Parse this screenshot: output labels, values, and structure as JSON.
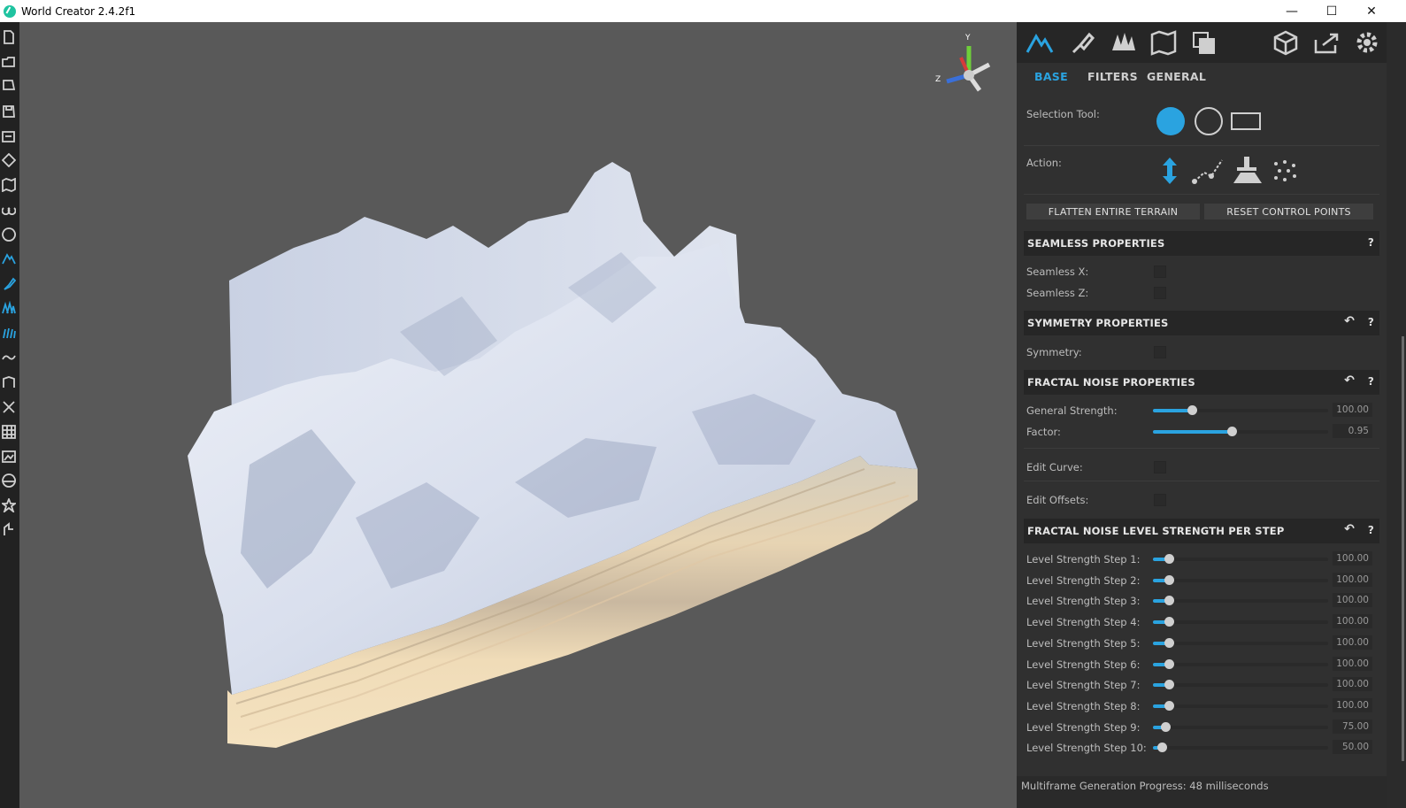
{
  "window": {
    "title": "World Creator 2.4.2f1",
    "minimize": "—",
    "maximize": "☐",
    "close": "✕"
  },
  "gizmo": {
    "y": "Y",
    "z": "Z"
  },
  "left_toolbar": {
    "icons": [
      "new-file-icon",
      "open-folder-icon",
      "open-recent-icon",
      "save-icon",
      "save-as-icon",
      "import-icon",
      "map-icon",
      "binoculars-icon",
      "globe-icon",
      "terrain-icon",
      "brush-icon",
      "trees-icon",
      "grass-icon",
      "river-icon",
      "texture-icon",
      "nodes-icon",
      "grid-icon",
      "image-icon",
      "sphere-icon",
      "settings-star-icon",
      "tool-icon"
    ]
  },
  "top_icons": [
    "terrain-tool-icon",
    "paint-brush-icon",
    "forest-icon",
    "map-layers-icon",
    "stack-icon",
    "cube-export-icon",
    "share-icon",
    "settings-gear-icon"
  ],
  "tabs": [
    {
      "label": "BASE",
      "active": true
    },
    {
      "label": "FILTERS",
      "active": false
    },
    {
      "label": "GENERAL",
      "active": false
    }
  ],
  "selection_tool": {
    "label": "Selection Tool:"
  },
  "action": {
    "label": "Action:"
  },
  "buttons": {
    "flatten": "FLATTEN ENTIRE TERRAIN",
    "reset": "RESET CONTROL POINTS"
  },
  "seamless": {
    "title": "SEAMLESS PROPERTIES",
    "help": "?",
    "x_label": "Seamless X:",
    "z_label": "Seamless Z:"
  },
  "symmetry": {
    "title": "SYMMETRY PROPERTIES",
    "help": "?",
    "label": "Symmetry:"
  },
  "fractal": {
    "title": "FRACTAL NOISE PROPERTIES",
    "help": "?",
    "general_strength_label": "General Strength:",
    "general_strength_value": "100.00",
    "general_strength_fraction": 0.22,
    "factor_label": "Factor:",
    "factor_value": "0.95",
    "factor_fraction": 0.45,
    "edit_curve_label": "Edit Curve:",
    "edit_offsets_label": "Edit Offsets:"
  },
  "levels": {
    "title": "FRACTAL NOISE LEVEL STRENGTH PER STEP",
    "help": "?",
    "steps": [
      {
        "label": "Level Strength Step 1:",
        "value": "100.00",
        "fraction": 0.09
      },
      {
        "label": "Level Strength Step 2:",
        "value": "100.00",
        "fraction": 0.09
      },
      {
        "label": "Level Strength Step 3:",
        "value": "100.00",
        "fraction": 0.09
      },
      {
        "label": "Level Strength Step 4:",
        "value": "100.00",
        "fraction": 0.09
      },
      {
        "label": "Level Strength Step 5:",
        "value": "100.00",
        "fraction": 0.09
      },
      {
        "label": "Level Strength Step 6:",
        "value": "100.00",
        "fraction": 0.09
      },
      {
        "label": "Level Strength Step 7:",
        "value": "100.00",
        "fraction": 0.09
      },
      {
        "label": "Level Strength Step 8:",
        "value": "100.00",
        "fraction": 0.09
      },
      {
        "label": "Level Strength Step 9:",
        "value": "75.00",
        "fraction": 0.07
      },
      {
        "label": "Level Strength Step 10:",
        "value": "50.00",
        "fraction": 0.05
      }
    ]
  },
  "status": {
    "text": "Multiframe Generation Progress: 48 milliseconds"
  },
  "colors": {
    "accent": "#2aa3e0",
    "panel": "#303030",
    "viewport": "#595959"
  }
}
